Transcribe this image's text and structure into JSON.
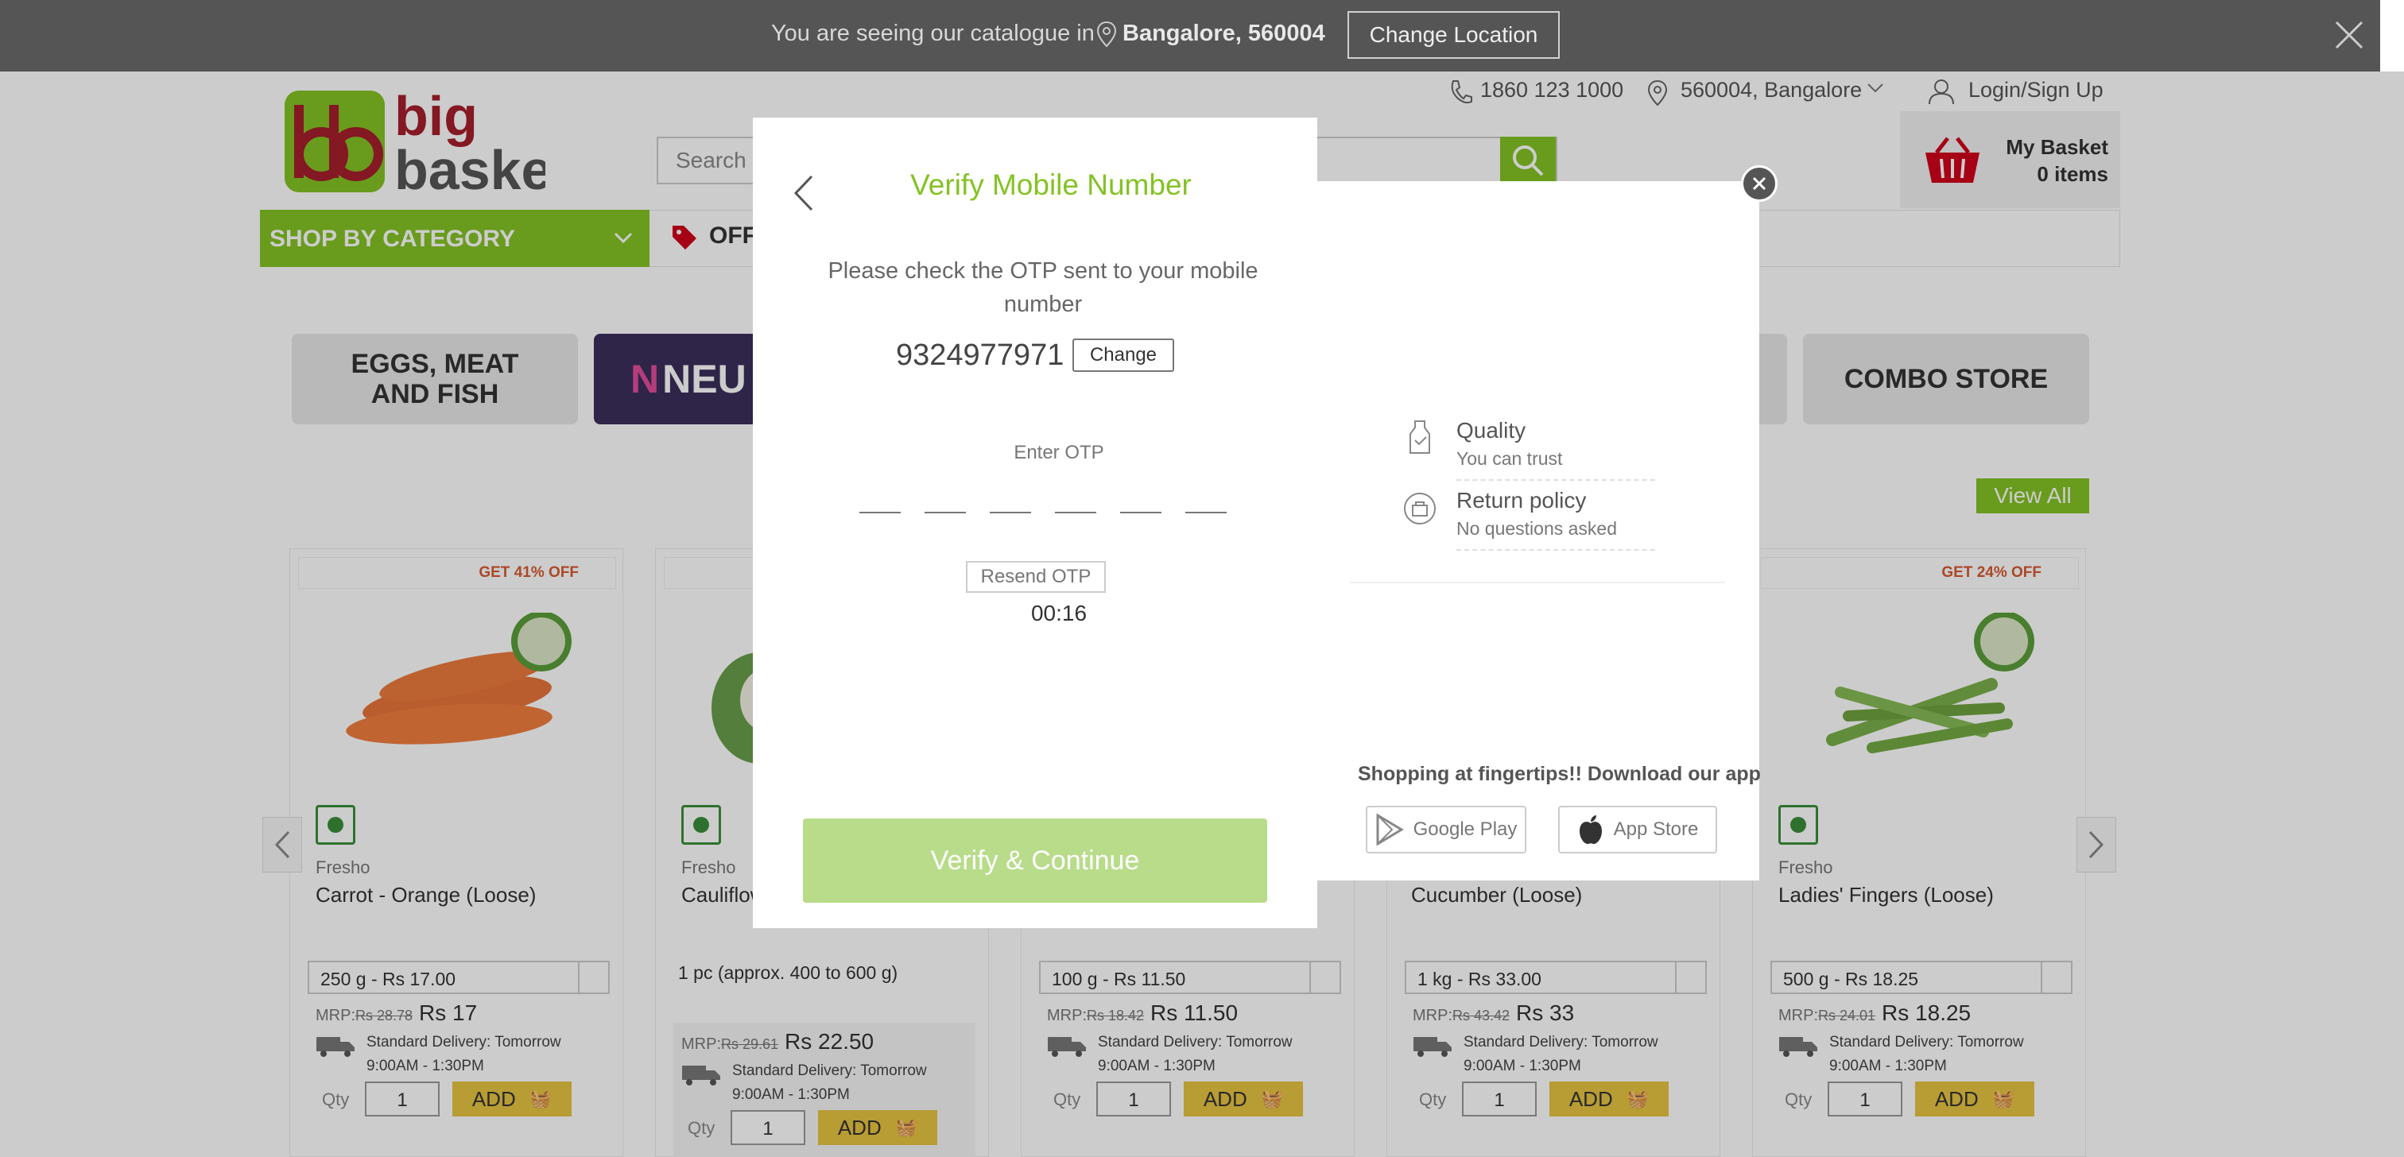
{
  "location_bar": {
    "message": "You are seeing our catalogue in",
    "city": "Bangalore, 560004",
    "change_label": "Change Location"
  },
  "header": {
    "phone": "1860 123 1000",
    "location": "560004, Bangalore",
    "login": "Login/Sign Up",
    "search_placeholder": "Search",
    "basket_label": "My Basket",
    "basket_count": "0 items",
    "logo_text_top": "big",
    "logo_text_bottom": "basket"
  },
  "nav": {
    "shop_by_category": "SHOP BY CATEGORY",
    "offers": "OFF"
  },
  "category_tiles": [
    {
      "label_line1": "EGGS, MEAT",
      "label_line2": "AND FISH"
    },
    {
      "label": "NEU"
    },
    {
      "label": "COMBO STORE"
    }
  ],
  "view_all": "View All",
  "products": [
    {
      "offer": "GET 41% OFF",
      "brand": "Fresho",
      "name": "Carrot - Orange (Loose)",
      "pack": "250 g - Rs 17.00",
      "mrp_label": "MRP:",
      "mrp": "Rs 28.78",
      "price": "Rs 17",
      "delivery_1": "Standard Delivery: Tomorrow",
      "delivery_2": "9:00AM - 1:30PM",
      "qty_label": "Qty",
      "qty": "1",
      "add": "ADD"
    },
    {
      "offer": "",
      "brand": "Fresho",
      "name": "Cauliflow",
      "pack": "1 pc (approx. 400 to 600 g)",
      "mrp_label": "MRP:",
      "mrp": "Rs 29.61",
      "price": "Rs 22.50",
      "delivery_1": "Standard Delivery: Tomorrow",
      "delivery_2": "9:00AM - 1:30PM",
      "qty_label": "Qty",
      "qty": "1",
      "add": "ADD"
    },
    {
      "offer": "",
      "brand": "",
      "name": "",
      "pack": "100 g - Rs 11.50",
      "mrp_label": "MRP:",
      "mrp": "Rs 18.42",
      "price": "Rs 11.50",
      "delivery_1": "Standard Delivery: Tomorrow",
      "delivery_2": "9:00AM - 1:30PM",
      "qty_label": "Qty",
      "qty": "1",
      "add": "ADD"
    },
    {
      "offer": "",
      "brand": "",
      "name": "Cucumber (Loose)",
      "pack": "1 kg - Rs 33.00",
      "mrp_label": "MRP:",
      "mrp": "Rs 43.42",
      "price": "Rs 33",
      "delivery_1": "Standard Delivery: Tomorrow",
      "delivery_2": "9:00AM - 1:30PM",
      "qty_label": "Qty",
      "qty": "1",
      "add": "ADD"
    },
    {
      "offer": "GET 24% OFF",
      "brand": "Fresho",
      "name": "Ladies' Fingers (Loose)",
      "pack": "500 g - Rs 18.25",
      "mrp_label": "MRP:",
      "mrp": "Rs 24.01",
      "price": "Rs 18.25",
      "delivery_1": "Standard Delivery: Tomorrow",
      "delivery_2": "9:00AM - 1:30PM",
      "qty_label": "Qty",
      "qty": "1",
      "add": "ADD"
    }
  ],
  "modal": {
    "title": "Verify Mobile Number",
    "subtitle": "Please check the OTP sent to your mobile number",
    "phone": "9324977971",
    "change_label": "Change",
    "enter_otp": "Enter OTP",
    "resend": "Resend OTP",
    "timer": "00:16",
    "verify": "Verify & Continue",
    "features": [
      {
        "title": "Quality",
        "subtitle": "You can trust"
      },
      {
        "title": "Return policy",
        "subtitle": "No questions asked"
      }
    ],
    "app_promo": "Shopping at fingertips!! Download our app",
    "google_play": "Google Play",
    "app_store": "App Store"
  },
  "colors": {
    "brand_green": "#84c225",
    "brand_red": "#a61f2c",
    "add_button": "#e6c442"
  }
}
